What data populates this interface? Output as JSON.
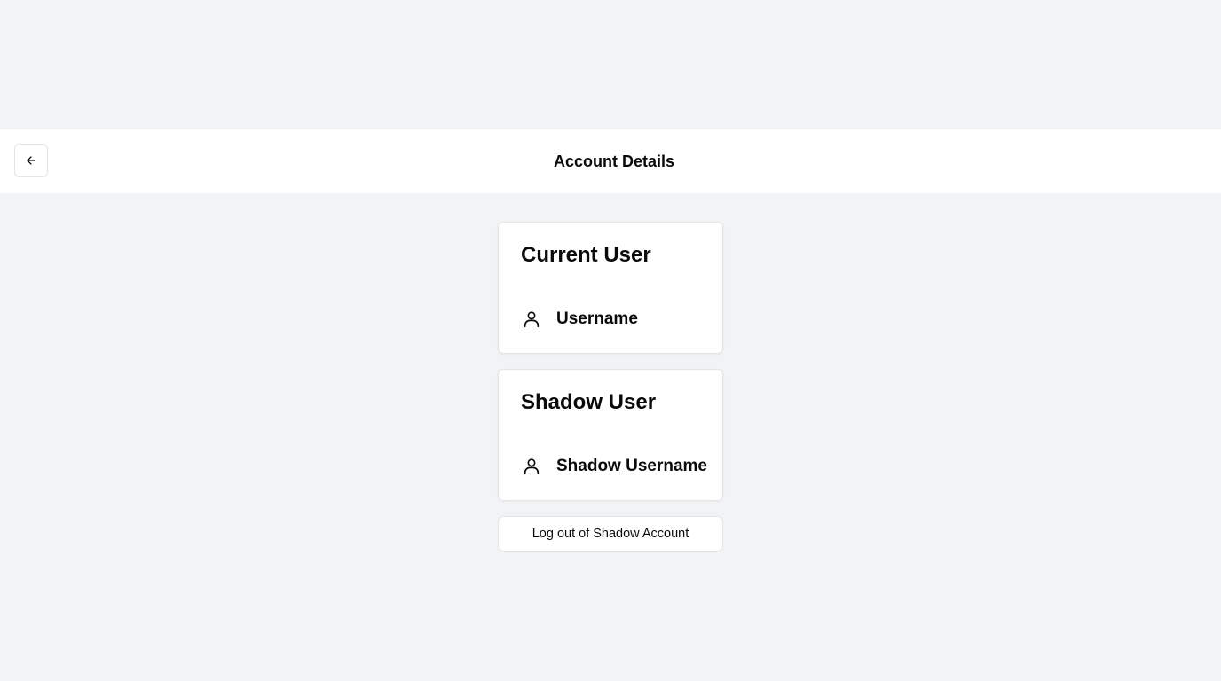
{
  "header": {
    "title": "Account Details",
    "back_icon": "arrow-left-icon"
  },
  "current_user": {
    "title": "Current User",
    "icon": "user-icon",
    "username": "Username"
  },
  "shadow_user": {
    "title": "Shadow User",
    "icon": "user-icon",
    "username": "Shadow Username"
  },
  "actions": {
    "logout_label": "Log out of Shadow Account"
  },
  "colors": {
    "background": "#f2f3f5",
    "surface": "#ffffff",
    "border": "#e4e4e7",
    "text": "#0a0a0a"
  }
}
